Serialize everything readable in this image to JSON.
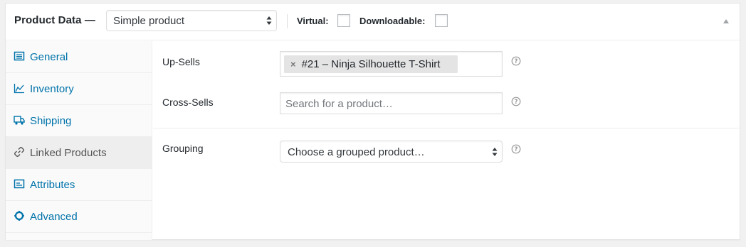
{
  "header": {
    "title": "Product Data —",
    "product_type": "Simple product",
    "virtual_label": "Virtual:",
    "downloadable_label": "Downloadable:",
    "virtual_checked": false,
    "downloadable_checked": false
  },
  "sidebar": {
    "tabs": [
      {
        "label": "General",
        "icon": "general-icon",
        "active": false
      },
      {
        "label": "Inventory",
        "icon": "inventory-icon",
        "active": false
      },
      {
        "label": "Shipping",
        "icon": "shipping-truck-icon",
        "active": false
      },
      {
        "label": "Linked Products",
        "icon": "link-icon",
        "active": true
      },
      {
        "label": "Attributes",
        "icon": "attributes-icon",
        "active": false
      },
      {
        "label": "Advanced",
        "icon": "advanced-gear-icon",
        "active": false
      }
    ]
  },
  "fields": {
    "upsells_label": "Up-Sells",
    "upsells_selected": "#21 – Ninja Silhouette T-Shirt",
    "upsells_remove": "×",
    "crosssells_label": "Cross-Sells",
    "crosssells_placeholder": "Search for a product…",
    "grouping_label": "Grouping",
    "grouping_value": "Choose a grouped product…"
  },
  "colors": {
    "link": "#0073aa",
    "active_tab_bg": "#eeeeee",
    "chip_bg": "#e4e4e4"
  }
}
